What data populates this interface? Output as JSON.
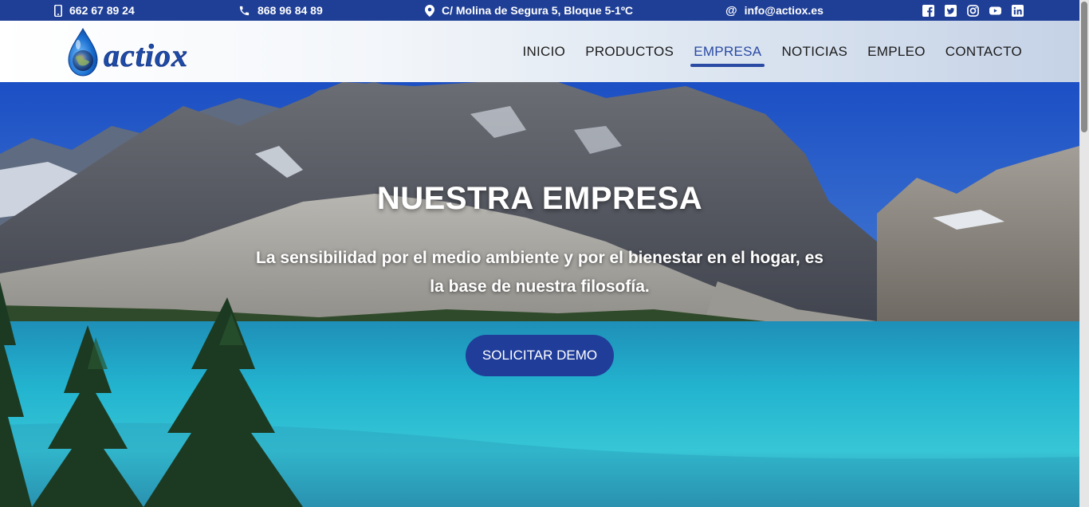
{
  "topbar": {
    "phone_mobile": "662 67 89 24",
    "phone_landline": "868 96 84 89",
    "address": "C/ Molina de Segura 5, Bloque 5-1ºC",
    "email": "info@actiox.es",
    "social_icons": [
      "facebook-icon",
      "twitter-icon",
      "instagram-icon",
      "youtube-icon",
      "linkedin-icon"
    ]
  },
  "brand": {
    "name": "actiox",
    "color": "#1e4aa8"
  },
  "nav": {
    "items": [
      {
        "label": "INICIO"
      },
      {
        "label": "PRODUCTOS"
      },
      {
        "label": "EMPRESA"
      },
      {
        "label": "NOTICIAS"
      },
      {
        "label": "EMPLEO"
      },
      {
        "label": "CONTACTO"
      }
    ],
    "active": "EMPRESA",
    "active_color": "#2a4aa3"
  },
  "hero": {
    "title": "NUESTRA EMPRESA",
    "subtitle_line1": "La sensibilidad por el medio ambiente y por el bienestar en el hogar, es",
    "subtitle_line2": "la base de nuestra filosofía.",
    "cta_label": "SOLICITAR DEMO",
    "cta_color": "#203d9a"
  }
}
